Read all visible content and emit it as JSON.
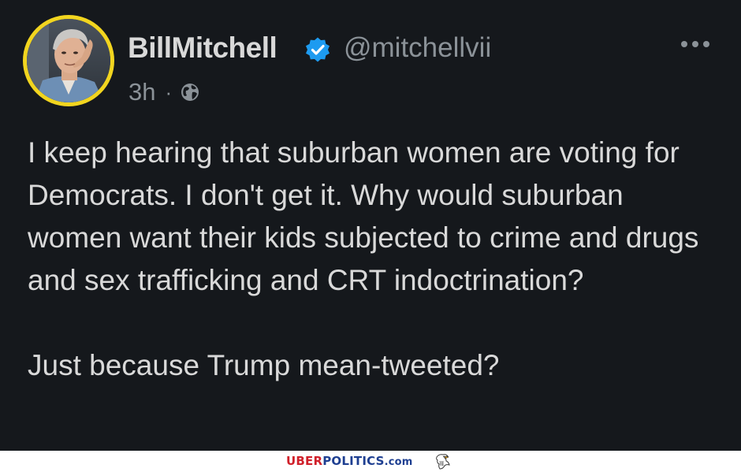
{
  "tweet": {
    "display_name": "BillMitchell",
    "handle": "@mitchellvii",
    "time": "3h",
    "separator": "·",
    "visibility_icon": "globe-icon",
    "verified_icon": "verified-badge-icon",
    "more_icon": "more-options-icon",
    "paragraphs": [
      "I keep hearing that suburban women are voting for Democrats. I don't get it. Why would suburban women want their kids subjected to crime and drugs and sex trafficking and CRT indoctrination?",
      "Just because Trump mean-tweeted?"
    ]
  },
  "footer": {
    "brand_part1": "UBER",
    "brand_part2": "POLITICS",
    "brand_part3": ".com",
    "logo_icon": "eagle-icon"
  },
  "colors": {
    "background": "#15181c",
    "text": "#d9d9d9",
    "secondary_text": "#8b9298",
    "verified": "#1d9bf0",
    "avatar_ring": "#f2d51f",
    "brand_red": "#d0202a",
    "brand_blue": "#1e3f91"
  }
}
